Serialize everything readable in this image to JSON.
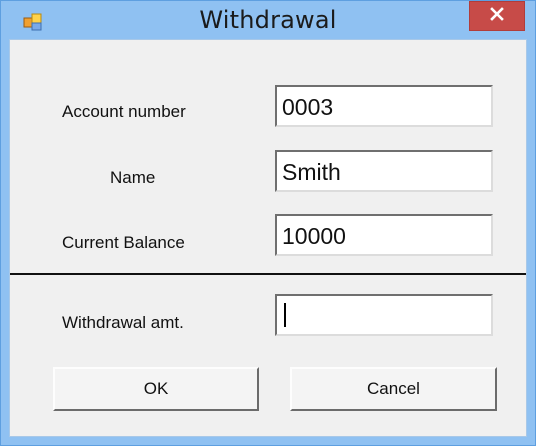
{
  "window": {
    "title": "Withdrawal",
    "icon": "winforms-app-icon",
    "close_icon": "close-icon",
    "colors": {
      "title_bar": "#8fc1f2",
      "close_button": "#c74b48",
      "client_bg": "#f0f0f0"
    }
  },
  "form": {
    "account_number": {
      "label": "Account number",
      "value": "0003"
    },
    "name": {
      "label": "Name",
      "value": "Smith"
    },
    "current_balance": {
      "label": "Current Balance",
      "value": "10000"
    },
    "withdrawal_amount": {
      "label": "Withdrawal amt.",
      "value": ""
    }
  },
  "buttons": {
    "ok": "OK",
    "cancel": "Cancel"
  }
}
